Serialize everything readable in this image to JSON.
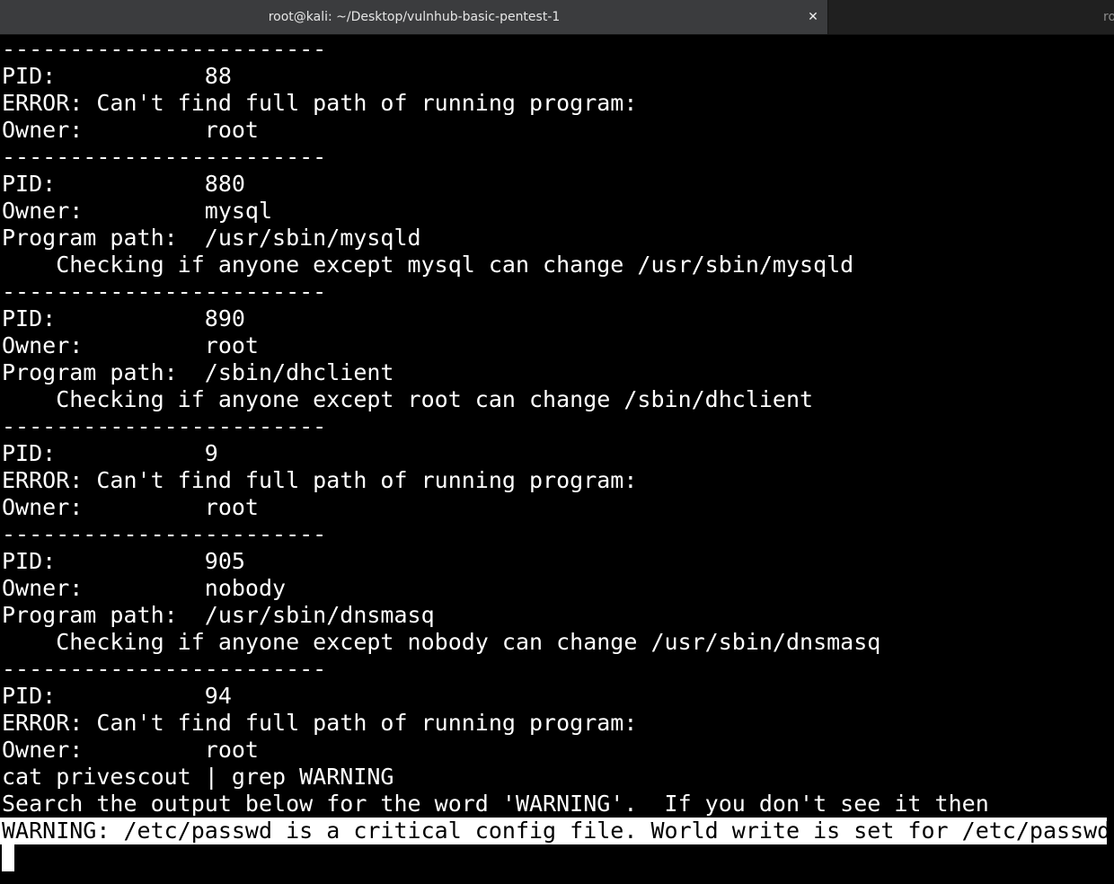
{
  "tabs": {
    "active_title": "root@kali: ~/Desktop/vulnhub-basic-pentest-1",
    "close_glyph": "✕",
    "inactive_title": "ro"
  },
  "terminal": {
    "lines": [
      "------------------------",
      "PID:           88",
      "ERROR: Can't find full path of running program:",
      "Owner:         root",
      "------------------------",
      "PID:           880",
      "Owner:         mysql",
      "Program path:  /usr/sbin/mysqld",
      "    Checking if anyone except mysql can change /usr/sbin/mysqld",
      "------------------------",
      "PID:           890",
      "Owner:         root",
      "Program path:  /sbin/dhclient",
      "    Checking if anyone except root can change /sbin/dhclient",
      "------------------------",
      "PID:           9",
      "ERROR: Can't find full path of running program:",
      "Owner:         root",
      "------------------------",
      "PID:           905",
      "Owner:         nobody",
      "Program path:  /usr/sbin/dnsmasq",
      "    Checking if anyone except nobody can change /usr/sbin/dnsmasq",
      "------------------------",
      "PID:           94",
      "ERROR: Can't find full path of running program:",
      "Owner:         root",
      "cat privescout | grep WARNING",
      "Search the output below for the word 'WARNING'.  If you don't see it then",
      "WARNING: /etc/passwd is a critical config file. World write is set for /etc/passwd"
    ]
  },
  "colors": {
    "background": "#000000",
    "foreground": "#ffffff",
    "tab_active": "#3b3c3e",
    "tab_inactive": "#202020"
  }
}
